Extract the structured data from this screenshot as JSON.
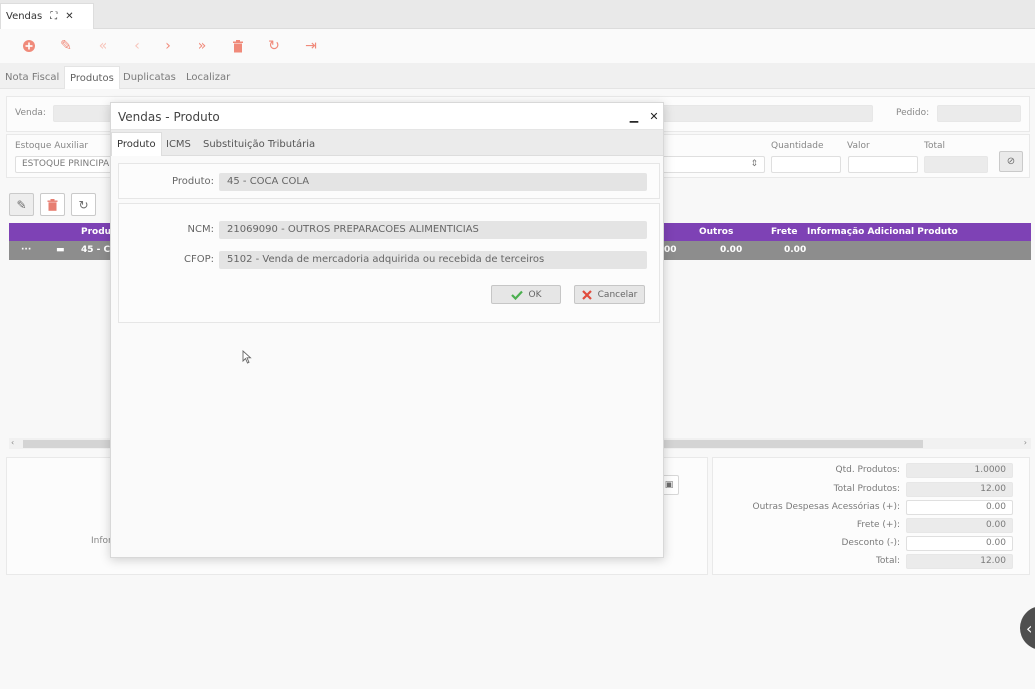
{
  "window_tab": {
    "title": "Vendas",
    "expand_icon": "expand-icon",
    "close_icon": "close-icon"
  },
  "toolbar": {
    "icons": [
      "add-circle-icon",
      "edit-pencil-icon",
      "first-record-icon",
      "prev-record-icon",
      "next-record-icon",
      "last-record-icon",
      "delete-trash-icon",
      "refresh-icon",
      "exit-icon"
    ]
  },
  "subtabs": [
    "Nota Fiscal",
    "Produtos",
    "Duplicatas",
    "Localizar"
  ],
  "form": {
    "venda_label": "Venda:",
    "pedido_label": "Pedido:",
    "estoque_label": "Estoque Auxiliar",
    "estoque_value": "ESTOQUE PRINCIPA",
    "quantidade_label": "Quantidade",
    "valor_label": "Valor",
    "total_label": "Total"
  },
  "grid": {
    "headers": {
      "produto": "Produt",
      "outros": "Outros",
      "frete": "Frete",
      "info": "Informação Adicional Produto"
    },
    "row": {
      "dots": "···",
      "produto": "45 - C",
      "partial": "00",
      "outros": "0.00",
      "frete": "0.00"
    }
  },
  "totals": [
    {
      "label": "Qtd. Produtos:",
      "value": "1.0000",
      "editable": false
    },
    {
      "label": "Total Produtos:",
      "value": "12.00",
      "editable": false
    },
    {
      "label": "Outras Despesas Acessórias (+):",
      "value": "0.00",
      "editable": true
    },
    {
      "label": "Frete (+):",
      "value": "0.00",
      "editable": false
    },
    {
      "label": "Desconto (-):",
      "value": "0.00",
      "editable": true
    },
    {
      "label": "Total:",
      "value": "12.00",
      "editable": false
    }
  ],
  "info_label_partial": "Infor",
  "modal": {
    "title": "Vendas - Produto",
    "minimize_icon": "minimize-icon",
    "close_icon": "close-icon",
    "tabs": [
      "Produto",
      "ICMS",
      "Substituição Tributária"
    ],
    "produto_label": "Produto:",
    "produto_value": "45 - COCA COLA",
    "ncm_label": "NCM:",
    "ncm_value": "21069090 - OUTROS PREPARACOES ALIMENTICIAS",
    "cfop_label": "CFOP:",
    "cfop_value": "5102 - Venda de mercadoria adquirida ou recebida de terceiros",
    "ok_label": "OK",
    "cancel_label": "Cancelar"
  }
}
